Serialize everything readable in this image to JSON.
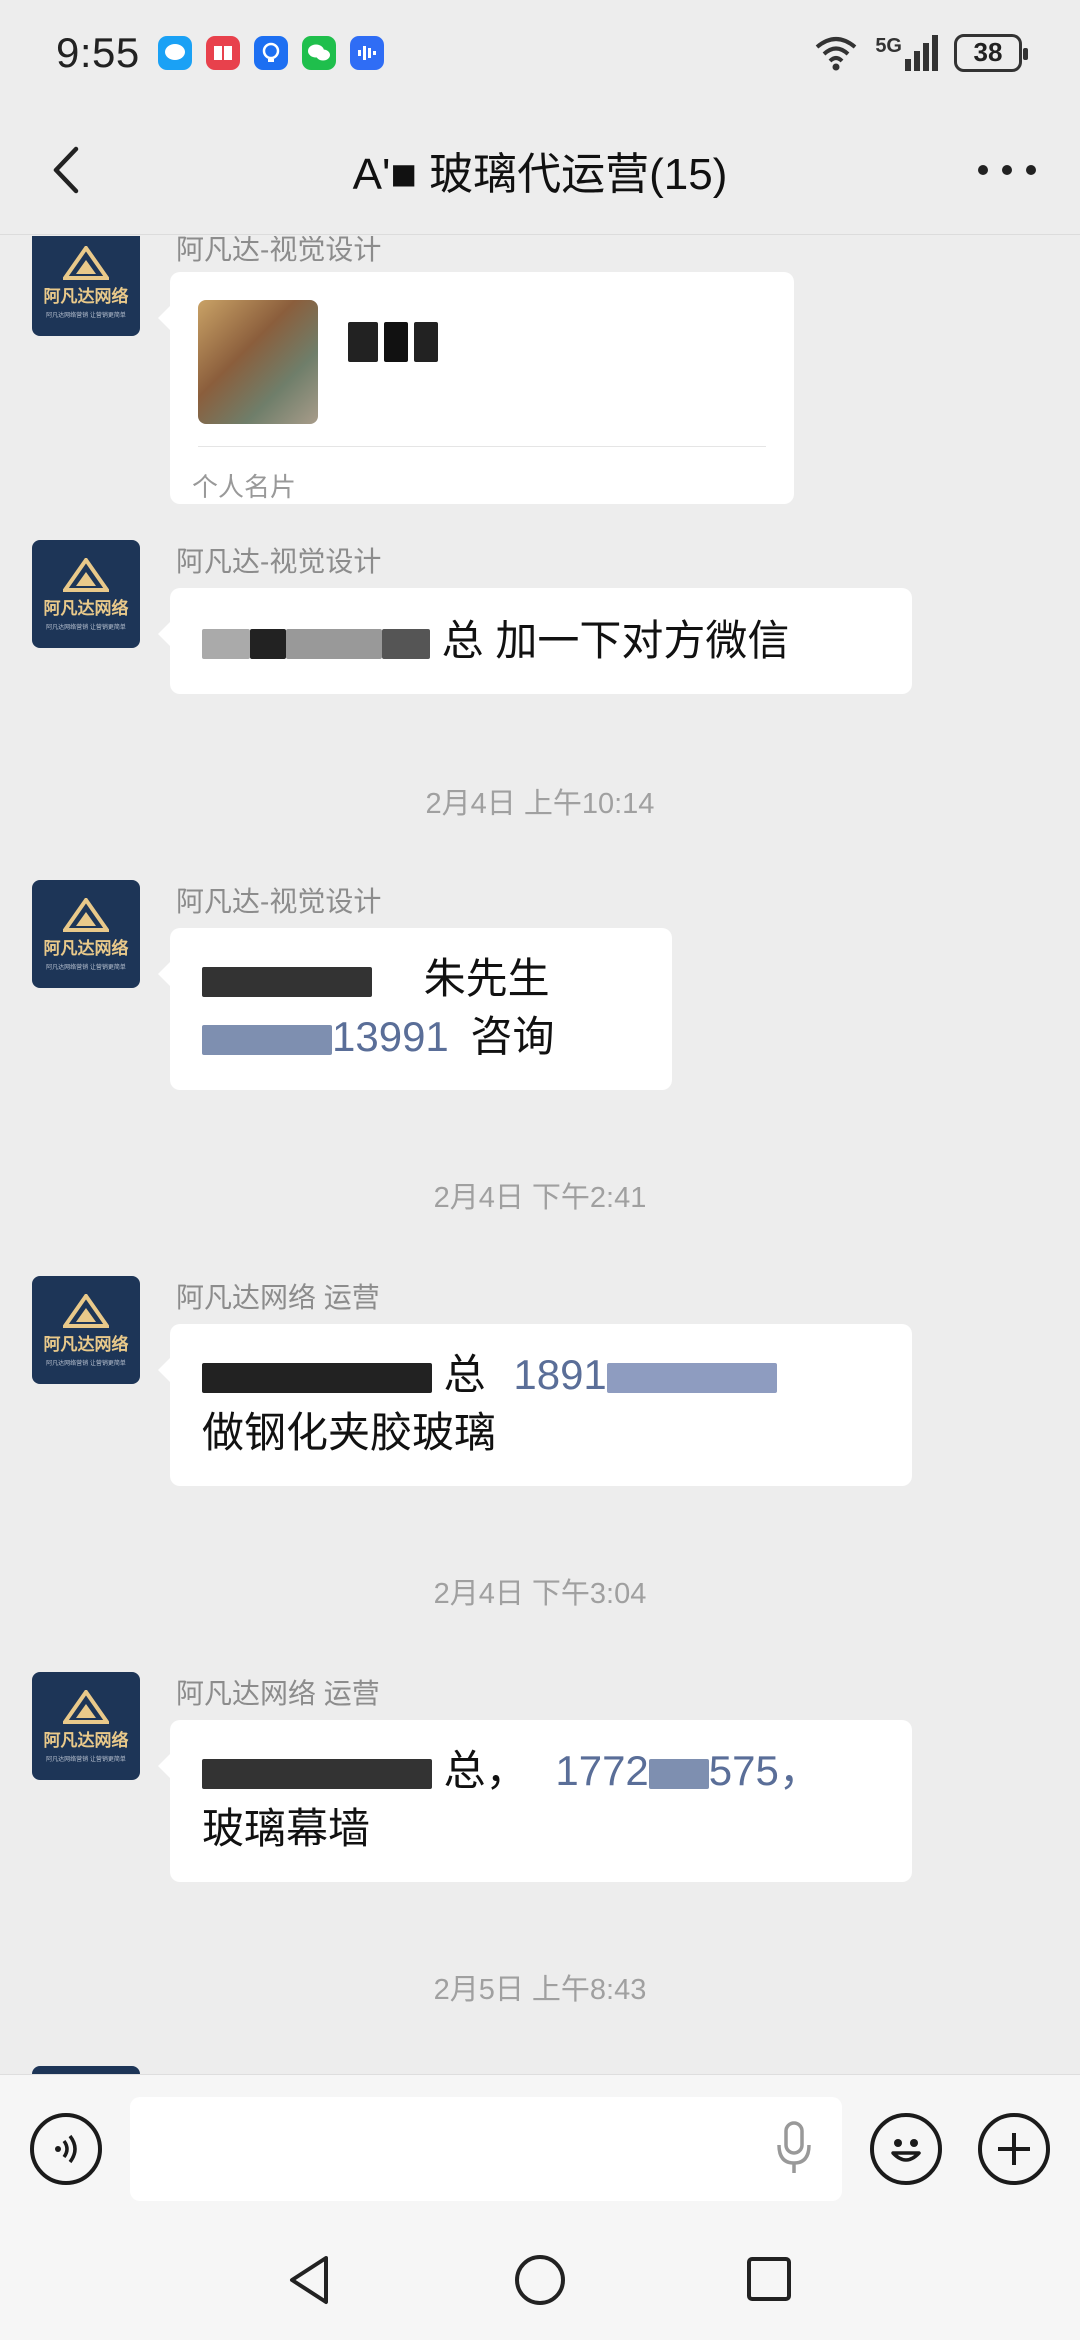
{
  "status_bar": {
    "time": "9:55",
    "network": "5G",
    "battery": "38"
  },
  "header": {
    "title": "A'■ 玻璃代运营(15)"
  },
  "avatar": {
    "brand": "阿凡达网络",
    "tagline": "阿凡达网络营销 让营销更简单"
  },
  "messages": [
    {
      "sender": "阿凡达-视觉设计",
      "type": "card",
      "card_label": "个人名片"
    },
    {
      "sender": "阿凡达-视觉设计",
      "text_a": "总  加一下对方微信"
    },
    {
      "sender": "阿凡达-视觉设计",
      "line1": "朱先生",
      "phone_tail": "13991",
      "line2_end": "咨询"
    },
    {
      "sender": "阿凡达网络 运营",
      "text_a": "总",
      "phone_a": "1891",
      "line2": "做钢化夹胶玻璃"
    },
    {
      "sender": "阿凡达网络 运营",
      "text_a": "总，",
      "phone_a": "1772",
      "phone_b": "575，",
      "line2": "玻璃幕墙"
    }
  ],
  "timestamps": [
    "2月4日 上午10:14",
    "2月4日 下午2:41",
    "2月4日 下午3:04",
    "2月5日 上午8:43"
  ],
  "colors": {
    "background": "#ededed",
    "bubble": "#ffffff",
    "link": "#5a6e98",
    "avatar_bg": "#1d3557",
    "avatar_gold": "#e9c98a"
  }
}
